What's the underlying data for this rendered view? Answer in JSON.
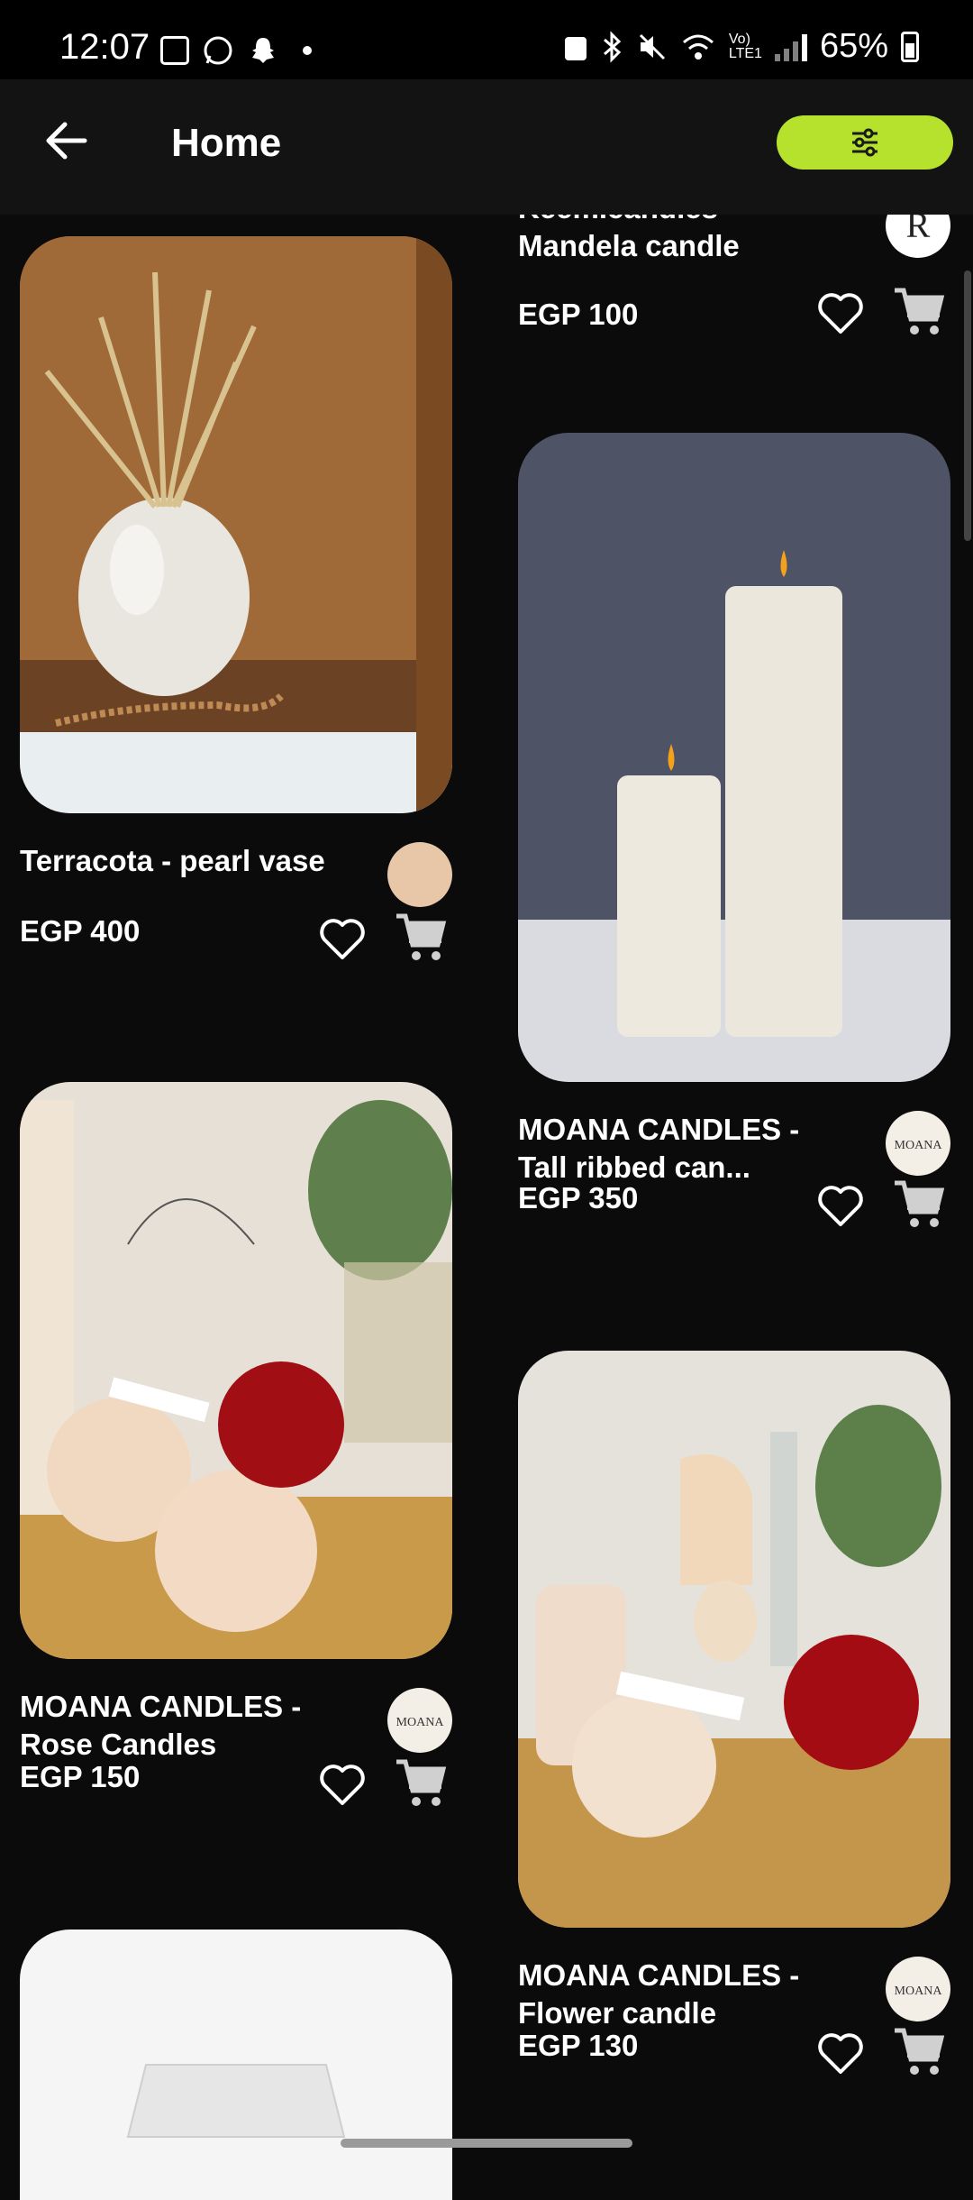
{
  "status": {
    "time": "12:07",
    "battery": "65%"
  },
  "header": {
    "title": "Home"
  },
  "colors": {
    "accent": "#b6e22e",
    "background": "#0b0b0b"
  },
  "products": {
    "p0": {
      "name": "Keem.candles - Mandela candle",
      "price": "EGP 100",
      "avatar_letter": "R"
    },
    "p1": {
      "name": "Terracota - pearl vase",
      "price": "EGP 400"
    },
    "p2": {
      "name": "MOANA CANDLES - Tall ribbed can...",
      "price": "EGP 350"
    },
    "p3": {
      "name": "MOANA CANDLES - Rose Candles",
      "price": "EGP 150"
    },
    "p4": {
      "name": "MOANA CANDLES - Flower candle",
      "price": "EGP 130"
    }
  },
  "icons": [
    "back-arrow-icon",
    "filter-sliders-icon",
    "heart-icon",
    "cart-icon"
  ]
}
